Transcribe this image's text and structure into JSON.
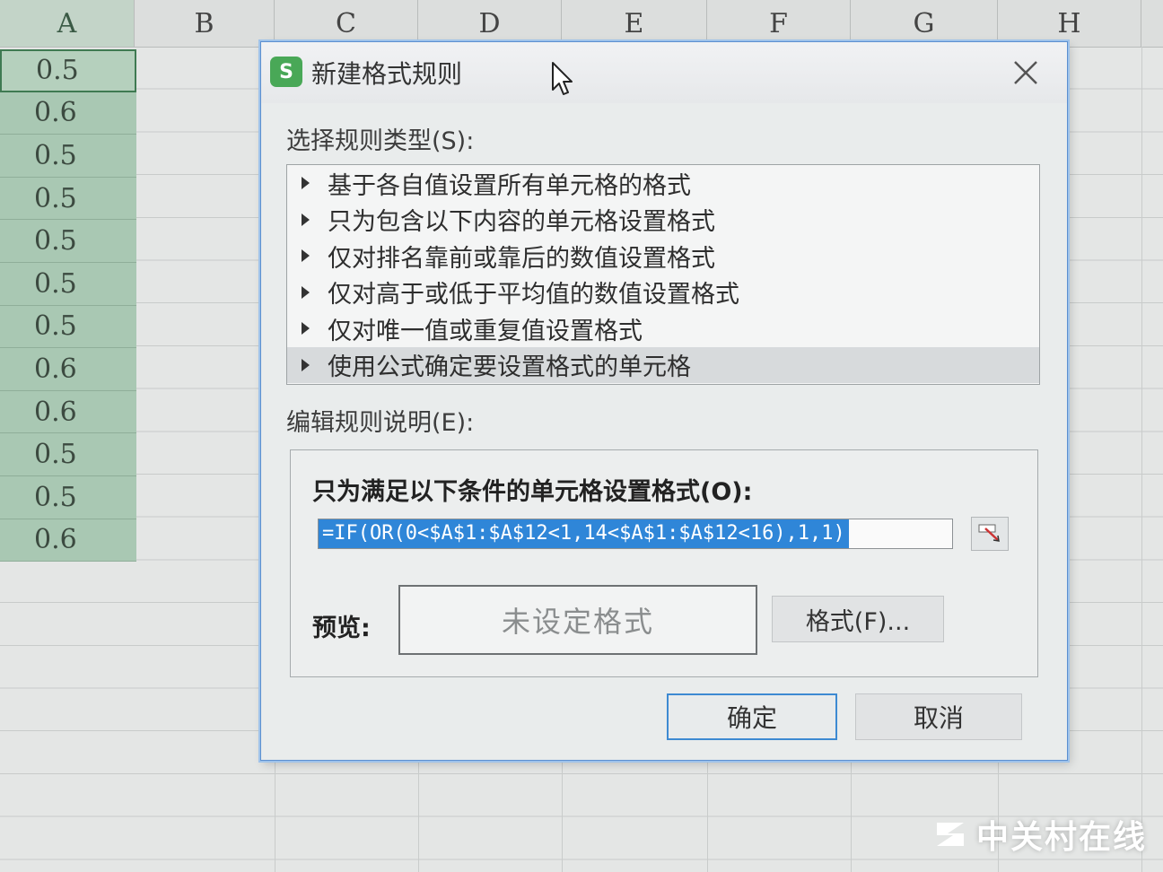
{
  "spreadsheet": {
    "columns": [
      "A",
      "B",
      "C",
      "D",
      "E",
      "F",
      "G",
      "H"
    ],
    "column_a_values": [
      "0.5",
      "0.6",
      "0.5",
      "0.5",
      "0.5",
      "0.5",
      "0.5",
      "0.6",
      "0.6",
      "0.5",
      "0.5",
      "0.6"
    ]
  },
  "dialog": {
    "title": "新建格式规则",
    "app_icon_letter": "S",
    "rule_type_label": "选择规则类型(S):",
    "rule_types": [
      "基于各自值设置所有单元格的格式",
      "只为包含以下内容的单元格设置格式",
      "仅对排名靠前或靠后的数值设置格式",
      "仅对高于或低于平均值的数值设置格式",
      "仅对唯一值或重复值设置格式",
      "使用公式确定要设置格式的单元格"
    ],
    "selected_rule_index": 5,
    "edit_label": "编辑规则说明(E):",
    "condition_label": "只为满足以下条件的单元格设置格式(O):",
    "formula": "=IF(OR(0<$A$1:$A$12<1,14<$A$1:$A$12<16),1,1)",
    "preview_label": "预览:",
    "preview_text": "未设定格式",
    "format_button": "格式(F)...",
    "ok_button": "确定",
    "cancel_button": "取消"
  },
  "watermark": "中关村在线",
  "colors": {
    "selection_blue": "#2f86d8",
    "app_icon_green": "#49a857",
    "column_a_fill": "#a9c8b3"
  }
}
